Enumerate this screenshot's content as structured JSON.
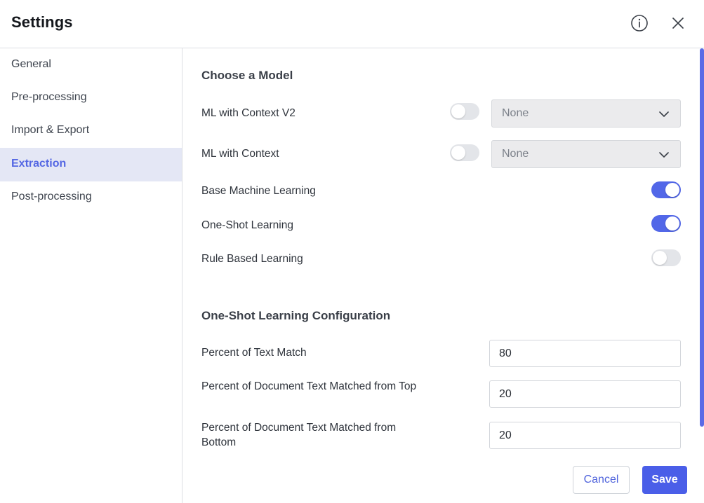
{
  "dialog": {
    "title": "Settings",
    "info_icon": "info-circle-icon",
    "close_icon": "close-x-icon"
  },
  "sidebar": {
    "items": [
      {
        "label": "General",
        "active": false
      },
      {
        "label": "Pre-processing",
        "active": false
      },
      {
        "label": "Import & Export",
        "active": false
      },
      {
        "label": "Extraction",
        "active": true
      },
      {
        "label": "Post-processing",
        "active": false
      }
    ]
  },
  "model_section": {
    "title": "Choose a Model",
    "rows": [
      {
        "label": "ML with Context V2",
        "enabled": false,
        "select_value": "None"
      },
      {
        "label": "ML with Context",
        "enabled": false,
        "select_value": "None"
      },
      {
        "label": "Base Machine Learning",
        "enabled": true
      },
      {
        "label": "One-Shot Learning",
        "enabled": true
      },
      {
        "label": "Rule Based Learning",
        "enabled": false
      }
    ]
  },
  "oneshot_section": {
    "title": "One-Shot Learning Configuration",
    "fields": [
      {
        "label": "Percent of Text Match",
        "value": "80"
      },
      {
        "label": "Percent of Document Text Matched from Top",
        "value": "20"
      },
      {
        "label": "Percent of Document Text Matched from Bottom",
        "value": "20"
      }
    ]
  },
  "footer": {
    "cancel_label": "Cancel",
    "save_label": "Save"
  },
  "colors": {
    "accent": "#4a5ee8",
    "active_nav_bg": "#e4e7f5",
    "toggle_off": "#e3e5e9"
  }
}
